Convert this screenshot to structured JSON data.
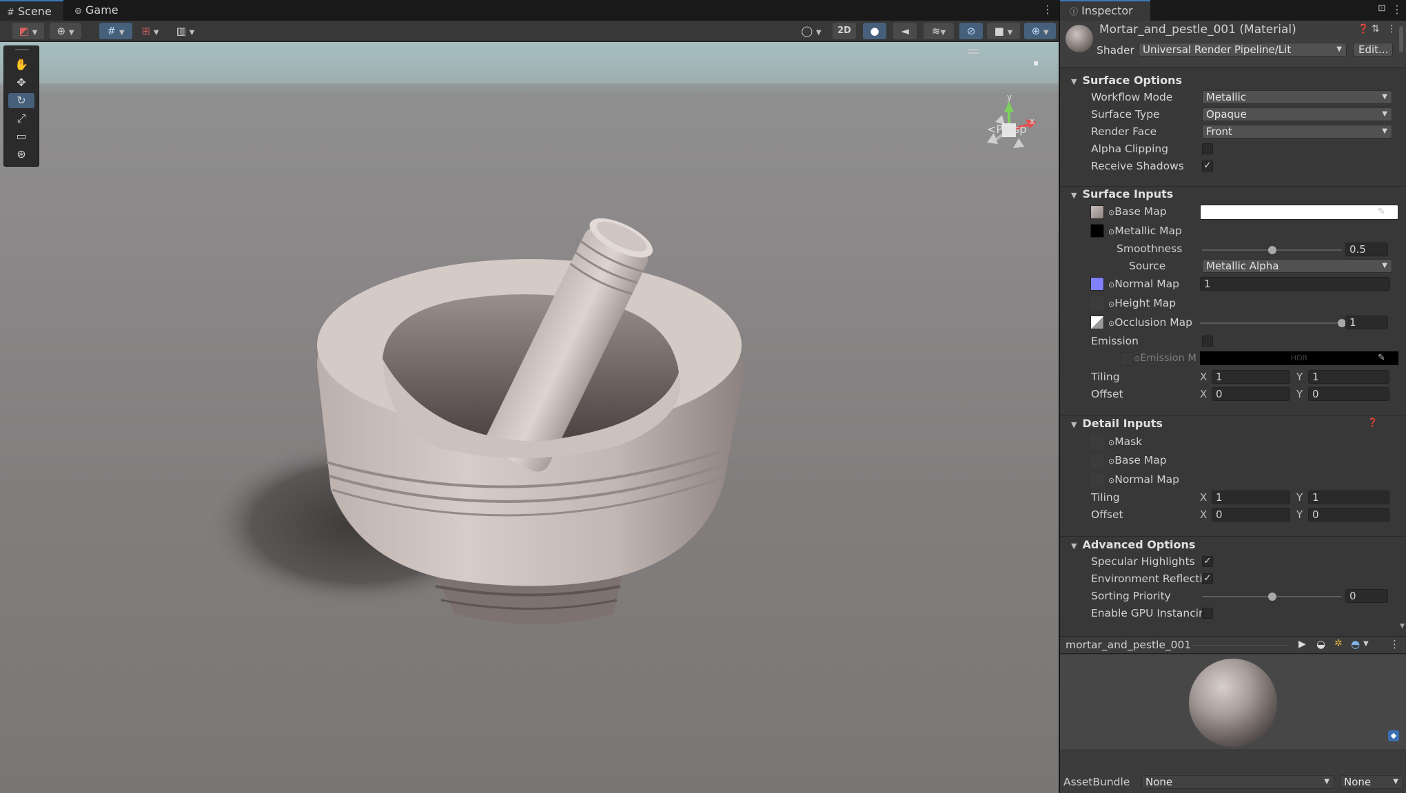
{
  "scene_tabs": {
    "scene": "Scene",
    "game": "Game"
  },
  "scene_toolbar": {
    "mode_2d": "2D"
  },
  "scene_view": {
    "projection_label": "<Persp",
    "gizmo_axes": {
      "x": "x",
      "y": "y"
    }
  },
  "inspector": {
    "tab": "Inspector",
    "material_title": "Mortar_and_pestle_001 (Material)",
    "shader_label": "Shader",
    "shader_value": "Universal Render Pipeline/Lit",
    "edit_button": "Edit...",
    "surface_options": {
      "title": "Surface Options",
      "workflow_mode": {
        "label": "Workflow Mode",
        "value": "Metallic"
      },
      "surface_type": {
        "label": "Surface Type",
        "value": "Opaque"
      },
      "render_face": {
        "label": "Render Face",
        "value": "Front"
      },
      "alpha_clipping": {
        "label": "Alpha Clipping",
        "checked": false
      },
      "receive_shadows": {
        "label": "Receive Shadows",
        "checked": true
      }
    },
    "surface_inputs": {
      "title": "Surface Inputs",
      "base_map": "Base Map",
      "metallic_map": "Metallic Map",
      "smoothness": {
        "label": "Smoothness",
        "value": "0.5",
        "level": 0.5
      },
      "source": {
        "label": "Source",
        "value": "Metallic Alpha"
      },
      "normal_map": {
        "label": "Normal Map",
        "value": "1"
      },
      "height_map": "Height Map",
      "occlusion_map": {
        "label": "Occlusion Map",
        "value": "1",
        "level": 1.0
      },
      "emission": {
        "label": "Emission",
        "checked": false
      },
      "emission_map": {
        "label": "Emission M",
        "hdr": "HDR"
      },
      "tiling": {
        "label": "Tiling",
        "x": "1",
        "y": "1"
      },
      "offset": {
        "label": "Offset",
        "x": "0",
        "y": "0"
      }
    },
    "detail_inputs": {
      "title": "Detail Inputs",
      "mask": "Mask",
      "base_map": "Base Map",
      "normal_map": "Normal Map",
      "tiling": {
        "label": "Tiling",
        "x": "1",
        "y": "1"
      },
      "offset": {
        "label": "Offset",
        "x": "0",
        "y": "0"
      }
    },
    "advanced_options": {
      "title": "Advanced Options",
      "specular_highlights": {
        "label": "Specular Highlights",
        "checked": true
      },
      "environment_reflections": {
        "label": "Environment Reflectio",
        "checked": true
      },
      "sorting_priority": {
        "label": "Sorting Priority",
        "value": "0",
        "level": 0.5
      },
      "gpu_instancing": {
        "label": "Enable GPU Instancing",
        "checked": false
      }
    },
    "axis_x": "X",
    "axis_y": "Y",
    "preview_title": "mortar_and_pestle_001",
    "asset_bundle": {
      "label": "AssetBundle",
      "name": "None",
      "variant": "None"
    }
  },
  "colors": {
    "accent": "#3a79bb",
    "normal_map_swatch": "#8080ff",
    "base_color": "#ffffff"
  }
}
